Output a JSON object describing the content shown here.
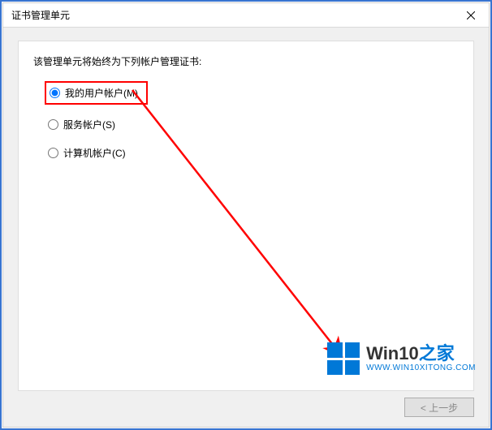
{
  "window": {
    "title": "证书管理单元"
  },
  "prompt": "该管理单元将始终为下列帐户管理证书:",
  "options": {
    "user": {
      "label": "我的用户帐户(M)",
      "selected": true,
      "highlighted": true
    },
    "service": {
      "label": "服务帐户(S)",
      "selected": false,
      "highlighted": false
    },
    "computer": {
      "label": "计算机帐户(C)",
      "selected": false,
      "highlighted": false
    }
  },
  "buttons": {
    "back": {
      "label": "< 上一步",
      "enabled": false
    }
  },
  "watermark": {
    "brand_main": "Win10",
    "brand_suffix": "之家",
    "url": "WWW.WIN10XITONG.COM"
  }
}
